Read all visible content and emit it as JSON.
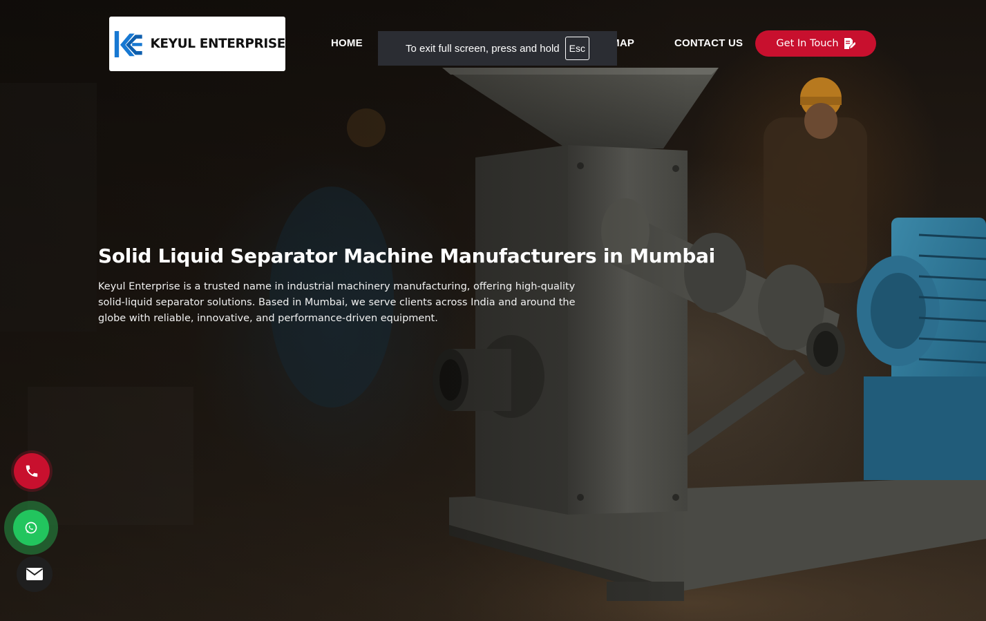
{
  "brand": {
    "name": "KEYUL ENTERPRISE",
    "logo_icon": "ke-monogram-logo",
    "logo_color": "#1778d2"
  },
  "nav": {
    "items": [
      {
        "label": "HOME"
      },
      {
        "label": "SITEMAP"
      },
      {
        "label": "CONTACT US"
      }
    ],
    "cta": {
      "label": "Get In Touch",
      "icon": "edit-note-icon",
      "color": "#c8102e"
    }
  },
  "fullscreen_notice": {
    "message": "To exit full screen, press and hold",
    "key": "Esc"
  },
  "hero": {
    "title": "Solid Liquid Separator Machine Manufacturers in Mumbai",
    "description": "Keyul Enterprise is a trusted name in industrial machinery manufacturing, offering high-quality solid-liquid separator solutions. Based in Mumbai, we serve clients across India and around the globe with reliable, innovative, and performance-driven equipment."
  },
  "floating_actions": [
    {
      "name": "phone",
      "icon": "phone-icon",
      "color": "#c8102e"
    },
    {
      "name": "whatsapp",
      "icon": "whatsapp-icon",
      "color": "#22c55e"
    },
    {
      "name": "email",
      "icon": "envelope-icon",
      "color": "#1f1f1f"
    }
  ]
}
